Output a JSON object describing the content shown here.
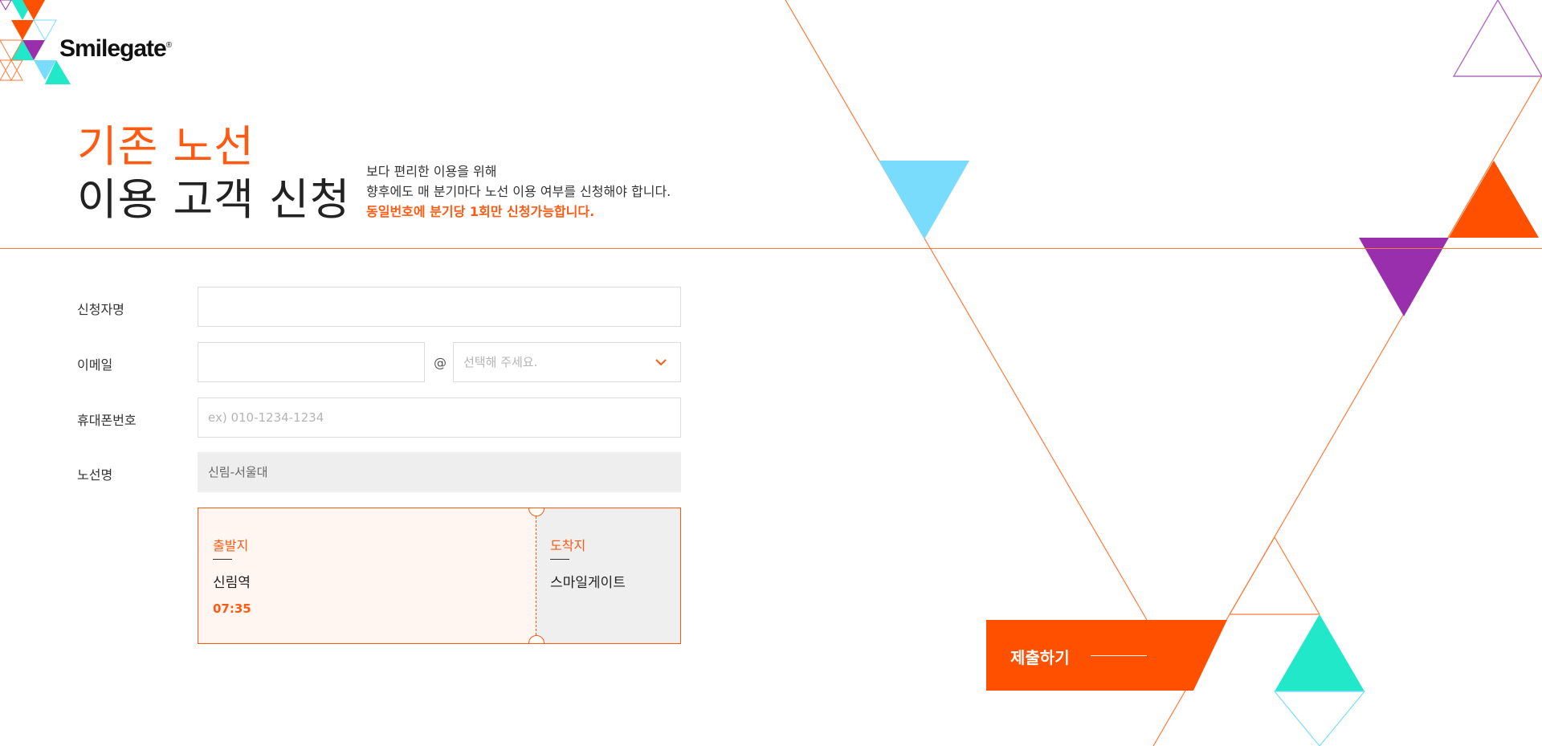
{
  "brand": {
    "name": "Smilegate",
    "reg_mark": "®"
  },
  "heading": {
    "line1": "기존 노선",
    "line2": "이용 고객 신청"
  },
  "description": {
    "line1": "보다 편리한 이용을 위해",
    "line2": "향후에도 매 분기마다 노선 이용 여부를 신청해야 합니다.",
    "warning": "동일번호에 분기당 1회만 신청가능합니다."
  },
  "form": {
    "name_label": "신청자명",
    "name_value": "",
    "email_label": "이메일",
    "email_local_value": "",
    "email_at": "@",
    "email_domain_placeholder": "선택해 주세요.",
    "phone_label": "휴대폰번호",
    "phone_placeholder": "ex) 010-1234-1234",
    "route_label": "노선명",
    "route_value": "신림-서울대"
  },
  "route": {
    "departure_caption": "출발지",
    "departure_name": "신림역",
    "departure_time": "07:35",
    "arrival_caption": "도착지",
    "arrival_name": "스마일게이트"
  },
  "submit": {
    "label": "제출하기"
  },
  "icons": {
    "select_arrow": "chevron-down-icon",
    "logo_mark": "triangle-mosaic-icon"
  },
  "colors": {
    "accent": "#ff5a12",
    "submit": "#ff5000",
    "purple": "#9a2fae",
    "cyan": "#79dcfd",
    "teal": "#20e8c8",
    "readonly_bg": "#eeeeee"
  }
}
